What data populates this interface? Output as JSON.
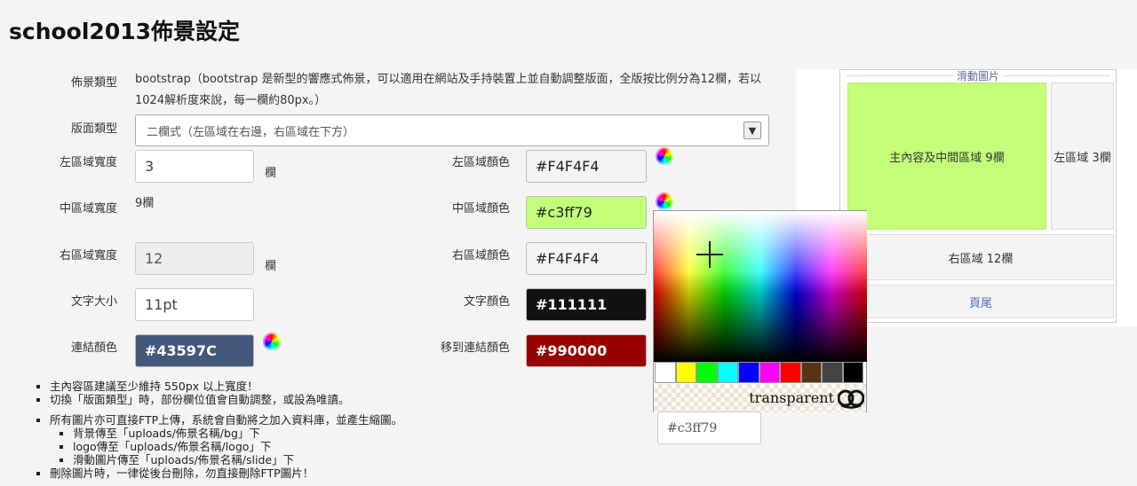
{
  "page": {
    "title": "school2013佈景設定"
  },
  "form": {
    "theme_type_label": "佈景類型",
    "theme_type_desc": "bootstrap（bootstrap 是新型的響應式佈景，可以適用在網站及手持裝置上並自動調整版面，全版按比例分為12欄，若以1024解析度來說，每一欄約80px。）",
    "layout_type_label": "版面類型",
    "layout_type_value": "二欄式（左區域在右邊，右區域在下方）",
    "left_width_label": "左區域寬度",
    "left_width_value": "3",
    "unit_col": "欄",
    "middle_width_label": "中區域寬度",
    "middle_width_value": "9欄",
    "right_width_label": "右區域寬度",
    "right_width_value": "12",
    "font_size_label": "文字大小",
    "font_size_value": "11pt",
    "link_color_label": "連結顏色",
    "link_color_value": "#43597C",
    "left_color_label": "左區域顏色",
    "left_color_value": "#F4F4F4",
    "middle_color_label": "中區域顏色",
    "middle_color_value": "#c3ff79",
    "right_color_label": "右區域顏色",
    "right_color_value": "#F4F4F4",
    "text_color_label": "文字顏色",
    "text_color_value": "#111111",
    "hover_color_label": "移到連結顏色",
    "hover_color_value": "#990000"
  },
  "notes": {
    "n1": "主內容區建議至少維持 550px 以上寬度！",
    "n2": "切換「版面類型」時，部份欄位值會自動調整，或設為唯讀。",
    "n3": "所有圖片亦可直接FTP上傳，系統會自動將之加入資料庫，並產生縮圖。",
    "n3a": "背景傳至「uploads/佈景名稱/bg」下",
    "n3b": "logo傳至「uploads/佈景名稱/logo」下",
    "n3c": "滑動圖片傳至「uploads/佈景名稱/slide」下",
    "n4": "刪除圖片時，一律從後台刪除，勿直接刪除FTP圖片！"
  },
  "preview": {
    "slide_label": "滑動圖片",
    "main_label": "主內容及中間區域 9欄",
    "left_label": "左區域 3欄",
    "right_label": "右區域 12欄",
    "footer_label": "頁尾"
  },
  "picker": {
    "transparent_label": "transparent",
    "hex_value": "#c3ff79",
    "palette": [
      "#ffffff",
      "#ffff00",
      "#00ff00",
      "#00ffff",
      "#0000ff",
      "#ff00ff",
      "#ff0000",
      "#5a3311",
      "#444444",
      "#000000"
    ]
  },
  "colors": {
    "link": "#43597C",
    "middle": "#c3ff79",
    "left": "#F4F4F4",
    "right": "#F4F4F4",
    "text": "#111111",
    "hover": "#990000"
  }
}
